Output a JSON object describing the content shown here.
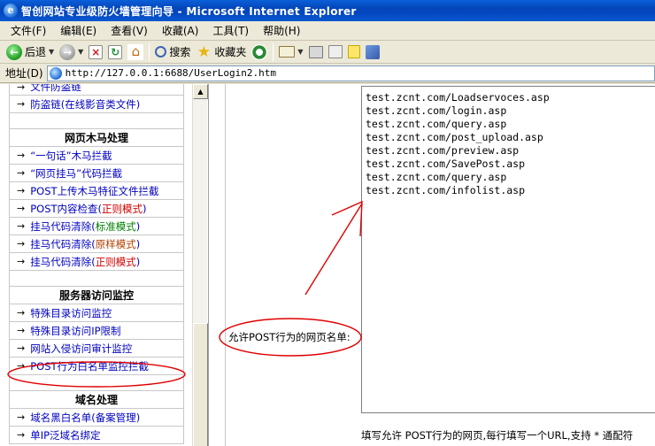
{
  "window": {
    "title": "智创网站专业级防火墙管理向导 - Microsoft Internet Explorer",
    "icon": "ie-icon"
  },
  "menu": [
    "文件(F)",
    "编辑(E)",
    "查看(V)",
    "收藏(A)",
    "工具(T)",
    "帮助(H)"
  ],
  "toolbar": {
    "back_label": "后退",
    "search_label": "搜索",
    "favorites_label": "收藏夹"
  },
  "address": {
    "label": "地址(D)",
    "url": "http://127.0.0.1:6688/UserLogin2.htm"
  },
  "nav": {
    "file_antileech": "文件防盗链",
    "media_antileech_a": "防盗链(",
    "media_antileech_b": "在线影音类文件",
    "media_antileech_c": ")",
    "section_webtrojan": "网页木马处理",
    "oneword_trojan": "“一句话”木马拦截",
    "webhang_code": "“网页挂马”代码拦截",
    "post_upload": "POST上传木马特征文件拦截",
    "post_check_a": "POST内容检查(",
    "post_check_b": "正则模式",
    "post_check_c": ")",
    "clean_std_a": "挂马代码清除(",
    "clean_std_b": "标准模式",
    "clean_std_c": ")",
    "clean_orig_a": "挂马代码清除(",
    "clean_orig_b": "原样模式",
    "clean_orig_c": ")",
    "clean_regex_a": "挂马代码清除(",
    "clean_regex_b": "正则模式",
    "clean_regex_c": ")",
    "section_server": "服务器访问监控",
    "special_dir": "特殊目录访问监控",
    "special_dir_ip": "特殊目录访问IP限制",
    "intrusion_audit": "网站入侵访问审计监控",
    "post_whitelist": "POST行为白名单监控拦截",
    "section_domain": "域名处理",
    "domain_black_a": "域名黑白名单(",
    "domain_black_b": "备案管理",
    "domain_black_c": ")",
    "single_ip": "单IP泛域名绑定"
  },
  "form": {
    "post_label": "允许POST行为的网页名单:",
    "urls": [
      "test.zcnt.com/Loadservoces.asp",
      "test.zcnt.com/login.asp",
      "test.zcnt.com/query.asp",
      "test.zcnt.com/post_upload.asp",
      "test.zcnt.com/preview.asp",
      "test.zcnt.com/SavePost.asp",
      "test.zcnt.com/query.asp",
      "test.zcnt.com/infolist.asp"
    ],
    "hint": "填写允许 POST行为的网页,每行填写一个URL,支持 * 通配符"
  },
  "colors": {
    "annotation": "#e00000",
    "regex_mode": "#d00000",
    "std_mode": "#008000",
    "orig_mode": "#b04000"
  }
}
